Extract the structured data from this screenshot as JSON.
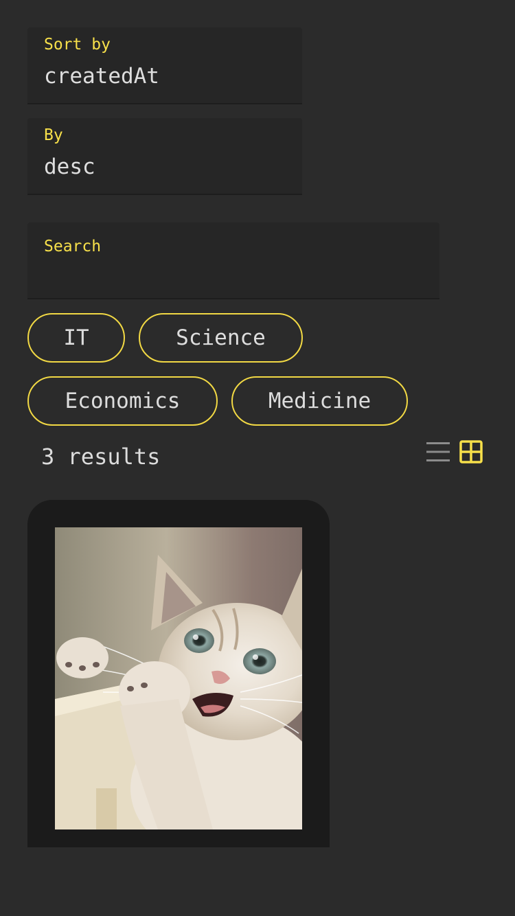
{
  "sort": {
    "label": "Sort by",
    "value": "createdAt"
  },
  "order": {
    "label": "By",
    "value": "desc"
  },
  "search": {
    "label": "Search",
    "value": ""
  },
  "categories": [
    {
      "label": "IT"
    },
    {
      "label": "Science"
    },
    {
      "label": "Economics"
    },
    {
      "label": "Medicine"
    }
  ],
  "results": {
    "text": "3 results"
  },
  "view": {
    "list_icon": "list-icon",
    "grid_icon": "grid-icon",
    "active": "grid"
  },
  "items": [
    {
      "image": "kitten photo"
    }
  ],
  "colors": {
    "background": "#2b2b2b",
    "accent": "#f7e04a",
    "field_bg": "#262626",
    "card_bg": "#1b1b1b",
    "inactive_icon": "#8c8c8c"
  }
}
